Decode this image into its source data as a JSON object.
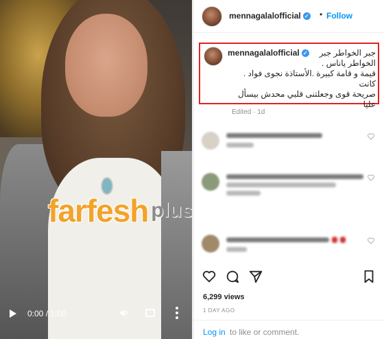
{
  "video": {
    "watermark_brand": "farfesh",
    "watermark_suffix": "plus.com",
    "time": "0:00 / 1:00"
  },
  "header": {
    "username": "mennagalalofficial",
    "separator": "•",
    "follow_label": "Follow"
  },
  "caption": {
    "username": "mennagalalofficial",
    "lines": [
      "جبر الخواطر جبر",
      "الخواطر ياناس .",
      "قيمة و قامة كبيرة .الأستاذة نجوى فواد . كانت",
      "صريحة قوى وجعلتنى قلبي محدش بيسأل",
      "عليا"
    ],
    "edited": "Edited · 1d"
  },
  "views": "6,299 views",
  "date": "1 DAY AGO",
  "login": {
    "link": "Log in",
    "rest": " to like or comment."
  },
  "colors": {
    "accent": "#0095f6",
    "verified": "#3897f0",
    "highlight_border": "#e02020",
    "watermark": "#f2a32a"
  }
}
